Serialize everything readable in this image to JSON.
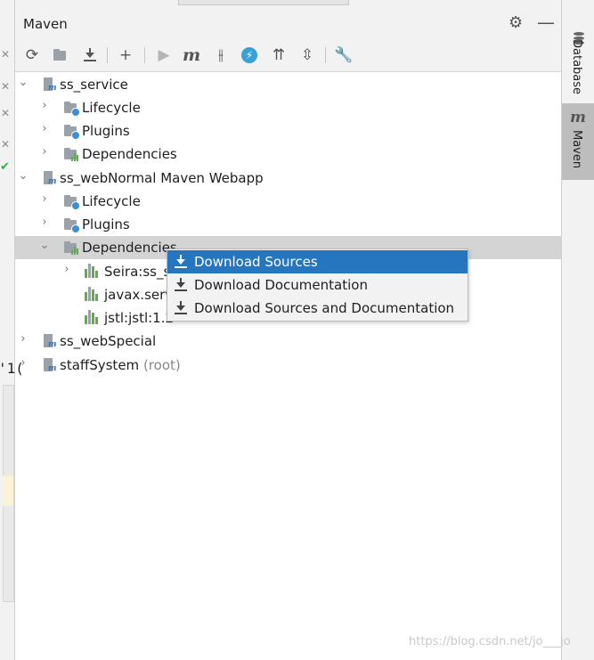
{
  "panel": {
    "title": "Maven"
  },
  "tree": {
    "ss_service": {
      "label": "ss_service",
      "lifecycle": "Lifecycle",
      "plugins": "Plugins",
      "dependencies": "Dependencies"
    },
    "ss_webNormal": {
      "label": "ss_webNormal Maven Webapp",
      "lifecycle": "Lifecycle",
      "plugins": "Plugins",
      "dependencies": "Dependencies",
      "deps": [
        "Seira:ss_s",
        "javax.serv",
        "jstl:jstl:1.2"
      ]
    },
    "ss_webSpecial": {
      "label": "ss_webSpecial"
    },
    "staffSystem": {
      "label": "staffSystem",
      "tag": "(root)"
    }
  },
  "context_menu": {
    "items": [
      {
        "label": "Download Sources",
        "active": true
      },
      {
        "label": "Download Documentation"
      },
      {
        "label": "Download Sources and Documentation"
      }
    ]
  },
  "right_sidebar": {
    "tabs": [
      "Database",
      "Maven"
    ],
    "active": "Maven"
  },
  "left_gutter": {
    "fragment": "'1("
  },
  "watermark": "https://blog.csdn.net/jo___jo",
  "icons": {
    "toolbar": [
      "refresh-icon",
      "add-folder-icon",
      "download-icon",
      "plus-icon",
      "run-icon",
      "maven-m-icon",
      "toggle-offline-icon",
      "skip-tests-icon",
      "show-dependencies-icon",
      "collapse-all-icon",
      "settings-wrench-icon"
    ]
  },
  "colors": {
    "selection": "#2675bf",
    "selected_row": "#d4d4d4",
    "panel_bg": "#f2f2f2"
  }
}
